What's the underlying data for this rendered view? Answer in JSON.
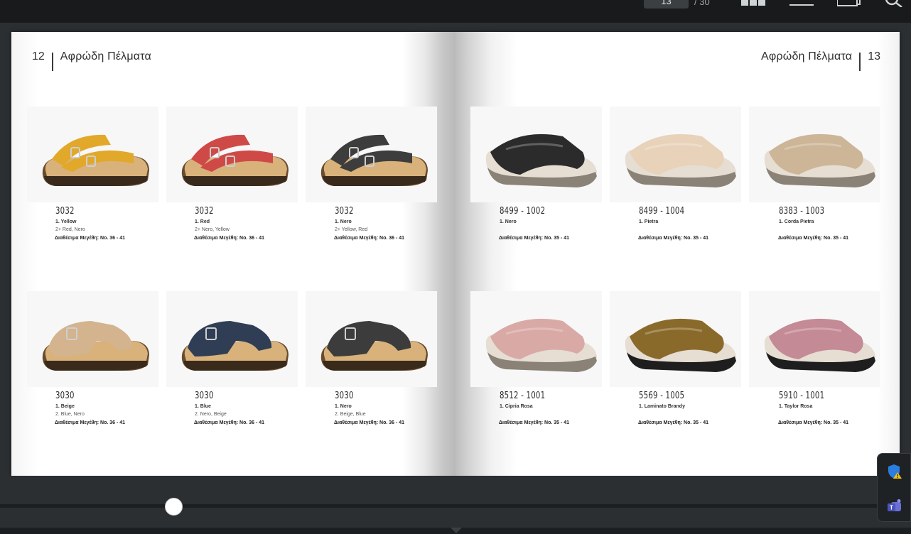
{
  "toolbar": {
    "page_current": "13",
    "page_separator": "/ 30",
    "icons": [
      "grid-view-icon",
      "list-view-icon",
      "copy-icon",
      "search-icon"
    ]
  },
  "left_page": {
    "number": "12",
    "title": "Αφρώδη Πέλματα"
  },
  "right_page": {
    "number": "13",
    "title": "Αφρώδη Πέλματα"
  },
  "products": [
    {
      "code": "3032",
      "color1": "1.   Yellow",
      "color2": "2+  Red, Nero",
      "sizes": "Διαθέσιμα Μεγέθη: No. 36 - 41",
      "shoe_color": "#e2a82a"
    },
    {
      "code": "3032",
      "color1": "1.   Red",
      "color2": "2+  Nero, Yellow",
      "sizes": "Διαθέσιμα Μεγέθη: No. 36 - 41",
      "shoe_color": "#cf4a47"
    },
    {
      "code": "3032",
      "color1": "1.   Nero",
      "color2": "2+  Yellow, Red",
      "sizes": "Διαθέσιμα Μεγέθη: No. 36 - 41",
      "shoe_color": "#3d3d3d"
    },
    {
      "code": "8499 - 1002",
      "color1": "1.   Nero",
      "color2": "",
      "sizes": "Διαθέσιμα Μεγέθη: No. 35 - 41",
      "shoe_color": "#2b2b2b"
    },
    {
      "code": "8499 - 1004",
      "color1": "1.   Pietra",
      "color2": "",
      "sizes": "Διαθέσιμα Μεγέθη: No. 35 - 41",
      "shoe_color": "#e8d2b9"
    },
    {
      "code": "8383 - 1003",
      "color1": "1.   Corda Pietra",
      "color2": "",
      "sizes": "Διαθέσιμα Μεγέθη: No. 35 - 41",
      "shoe_color": "#cdb597"
    },
    {
      "code": "3030",
      "color1": "1.   Beige",
      "color2": "2.   Blue, Nero",
      "sizes": "Διαθέσιμα Μεγέθη: No. 36 - 41",
      "shoe_color": "#d3b48f"
    },
    {
      "code": "3030",
      "color1": "1.   Blue",
      "color2": "2.   Nero, Beige",
      "sizes": "Διαθέσιμα Μεγέθη: No. 36 - 41",
      "shoe_color": "#2f3e55"
    },
    {
      "code": "3030",
      "color1": "1.   Nero",
      "color2": "2.   Beige, Blue",
      "sizes": "Διαθέσιμα Μεγέθη: No. 36 - 41",
      "shoe_color": "#3c3c3c"
    },
    {
      "code": "8512 - 1001",
      "color1": "1.   Cipria Rosa",
      "color2": "",
      "sizes": "Διαθέσιμα Μεγέθη: No. 35 - 41",
      "shoe_color": "#d9a9a6"
    },
    {
      "code": "5569 - 1005",
      "color1": "1.   Laminato Brandy",
      "color2": "",
      "sizes": "Διαθέσιμα Μεγέθη: No. 35 - 41",
      "shoe_color": "#8a6a2a"
    },
    {
      "code": "5910 - 1001",
      "color1": "1.   Taylor Rosa",
      "color2": "",
      "sizes": "Διαθέσιμα Μεγέθη: No. 35 - 41",
      "shoe_color": "#c48a95"
    }
  ],
  "slider": {
    "position_fraction": 0.19
  }
}
